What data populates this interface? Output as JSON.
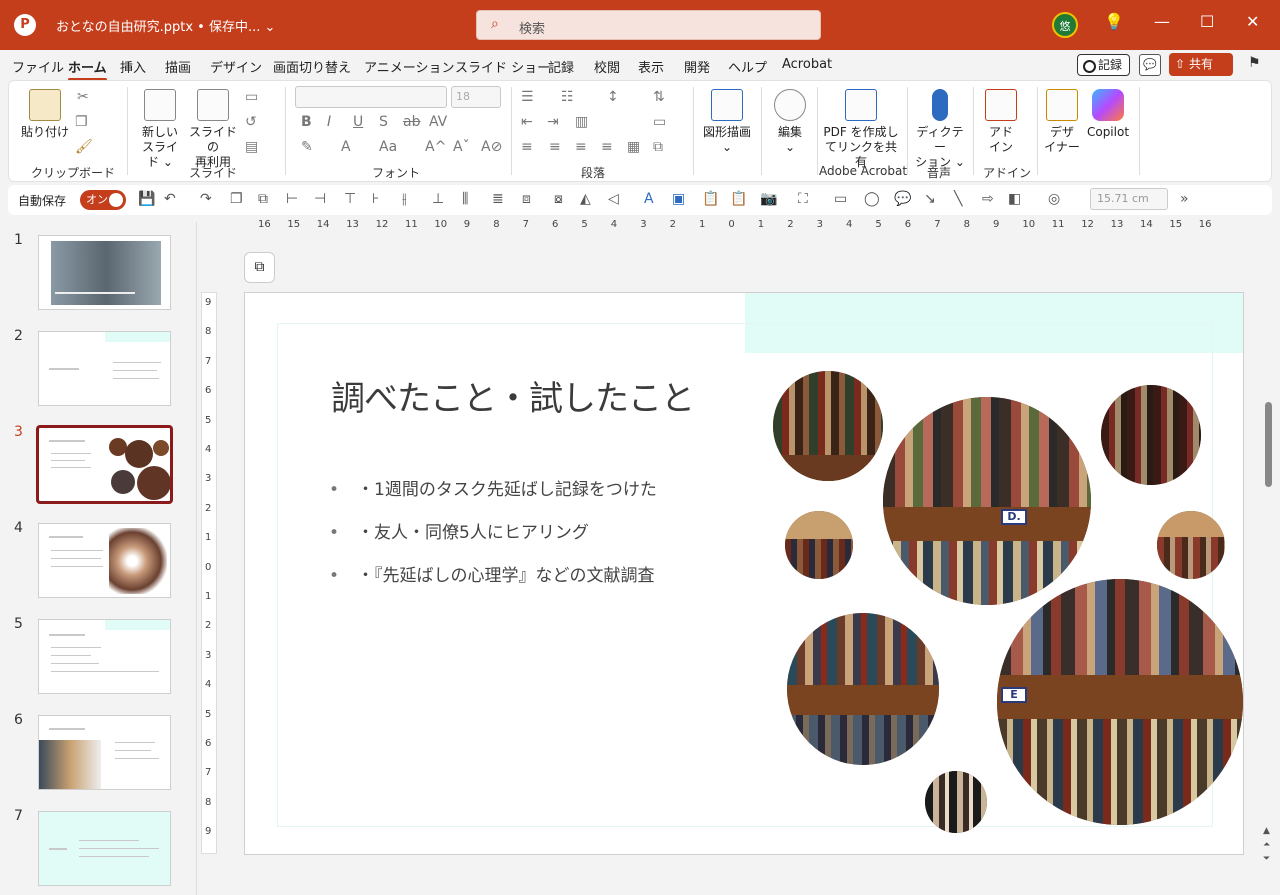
{
  "window": {
    "doc_title": "おとなの自由研究.pptx • 保存中... ⌄",
    "search_icon": "search-icon",
    "search_text": "検索",
    "avatar_text": "悠",
    "min": "—",
    "max": "☐",
    "close": "✕"
  },
  "menu": {
    "tabs": [
      "ファイル",
      "ホーム",
      "挿入",
      "描画",
      "デザイン",
      "画面切り替え",
      "アニメーション",
      "スライド ショー",
      "記録",
      "校閲",
      "表示",
      "開発",
      "ヘルプ",
      "Acrobat"
    ],
    "active": "ホーム",
    "record_label": "記録",
    "share_label": "共有"
  },
  "ribbon": {
    "paste": "貼り付け",
    "clipboard": "クリップボード",
    "new_slide_1": "新しい",
    "new_slide_2": "スライド ⌄",
    "reuse_1": "スライドの",
    "reuse_2": "再利用",
    "slides_group": "スライド",
    "font_size": "18",
    "font_group": "フォント",
    "para_group": "段落",
    "shapes_1": "図形描画",
    "shapes_2": "⌄",
    "edit_1": "編集",
    "edit_2": "⌄",
    "pdf_1": "PDF を作成し",
    "pdf_2": "てリンクを共有",
    "acrobat_group": "Adobe Acrobat",
    "dict_1": "ディクテー",
    "dict_2": "ション ⌄",
    "voice_group": "音声",
    "addin_1": "アド",
    "addin_2": "イン",
    "addin_group": "アドイン",
    "design_1": "デザ",
    "design_2": "イナー",
    "copilot": "Copilot"
  },
  "qat": {
    "autosave_label": "自動保存",
    "toggle_label": "オン",
    "dimension": "15.71 cm",
    "more": "»"
  },
  "ruler": {
    "h_ticks": [
      "16",
      "15",
      "14",
      "13",
      "12",
      "11",
      "10",
      "9",
      "8",
      "7",
      "6",
      "5",
      "4",
      "3",
      "2",
      "1",
      "0",
      "1",
      "2",
      "3",
      "4",
      "5",
      "6",
      "7",
      "8",
      "9",
      "10",
      "11",
      "12",
      "13",
      "14",
      "15",
      "16"
    ],
    "v_ticks": [
      "9",
      "8",
      "7",
      "6",
      "5",
      "4",
      "3",
      "2",
      "1",
      "0",
      "1",
      "2",
      "3",
      "4",
      "5",
      "6",
      "7",
      "8",
      "9"
    ]
  },
  "thumbnails": [
    {
      "num": "1"
    },
    {
      "num": "2"
    },
    {
      "num": "3"
    },
    {
      "num": "4"
    },
    {
      "num": "5"
    },
    {
      "num": "6"
    },
    {
      "num": "7"
    }
  ],
  "slide": {
    "title": "調べたこと・試したこと",
    "bullets": [
      "・1週間のタスク先延ばし記録をつけた",
      "・友人・同僚5人にヒアリング",
      "・『先延ばしの心理学』などの文献調査"
    ],
    "shelf_label_d": "D.",
    "shelf_label_e": "E"
  },
  "colors": {
    "accent": "#c43e1c",
    "slide_band": "#e1fbf7",
    "thumb_selected": "#8b1a1a"
  }
}
